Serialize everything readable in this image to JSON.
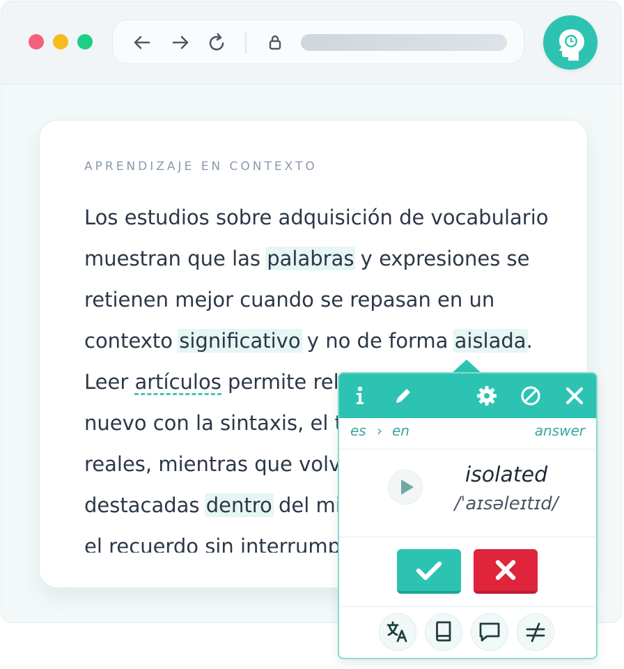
{
  "browser": {
    "traffic_lights": {
      "close": "#f46279",
      "minimize": "#f7bb1d",
      "zoom": "#1ccf86"
    },
    "nav_icons": [
      "arrow-left-icon",
      "arrow-right-icon",
      "reload-icon",
      "lock-icon"
    ],
    "extension_icon": "head-clock-icon",
    "accent": "#2cc3b2"
  },
  "article": {
    "eyebrow": "APRENDIZAJE EN CONTEXTO",
    "lines": [
      [
        {
          "t": "Los estudios sobre adquisición de vocabulario"
        }
      ],
      [
        {
          "t": "muestran que las "
        },
        {
          "t": "palabras",
          "hl": true
        },
        {
          "t": " y expresiones se"
        }
      ],
      [
        {
          "t": "retienen mejor cuando se repasan en un"
        }
      ],
      [
        {
          "t": "contexto "
        },
        {
          "t": "significativo",
          "hl": true
        },
        {
          "t": " y no de forma "
        },
        {
          "t": "aislada",
          "hl": true
        },
        {
          "t": "."
        }
      ],
      [
        {
          "t": "Leer "
        },
        {
          "t": "artículos",
          "ul": true
        },
        {
          "t": " permite relac"
        }
      ],
      [
        {
          "t": "nuevo con la sintaxis, el tor"
        }
      ],
      [
        {
          "t": "reales, mientras que volver"
        }
      ],
      [
        {
          "t": "destacadas "
        },
        {
          "t": "dentro",
          "hl": true
        },
        {
          "t": " del mis"
        }
      ],
      [
        {
          "t": "el recuerdo sin interrumpir"
        }
      ]
    ]
  },
  "popup": {
    "toolbar_icons": [
      "info-icon",
      "pencil-icon",
      "gear-icon",
      "block-icon",
      "close-icon"
    ],
    "source_lang": "es",
    "lang_separator": "›",
    "target_lang": "en",
    "answer_label": "answer",
    "translation": "isolated",
    "ipa": "/ˈaɪsəleɪtɪd/",
    "actions": {
      "correct_color": "#2cc3b2",
      "wrong_color": "#e0243b"
    },
    "bottom_icons": [
      "translate-icon",
      "book-icon",
      "comment-icon",
      "not-equal-icon"
    ]
  }
}
